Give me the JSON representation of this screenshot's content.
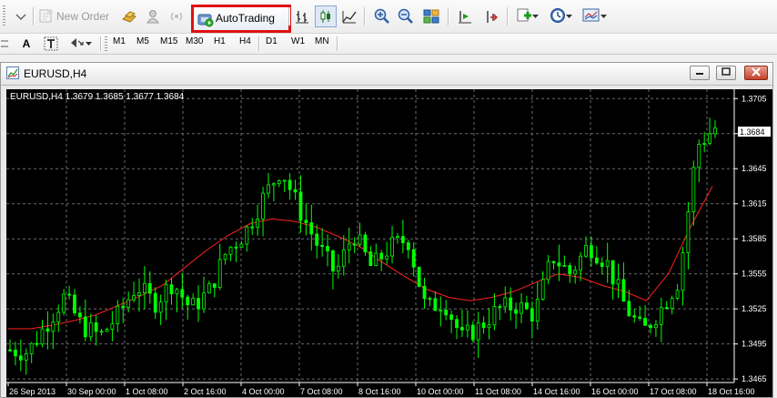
{
  "toolbar": {
    "new_order_label": "New Order",
    "autotrading_label": "AutoTrading",
    "timeframes": [
      "M1",
      "M5",
      "M15",
      "M30",
      "H1",
      "H4",
      "D1",
      "W1",
      "MN"
    ],
    "text_tool_label": "A",
    "icons": [
      "new-order-icon",
      "gold-bars-icon",
      "trader-icon",
      "signal-icon",
      "autotrading-icon",
      "bar-chart-icon",
      "candlestick-icon",
      "line-chart-icon",
      "zoom-in-icon",
      "zoom-out-icon",
      "tile-windows-icon",
      "chart-shift-icon",
      "autoscroll-icon",
      "indicators-icon",
      "periods-icon",
      "templates-icon"
    ]
  },
  "chart_window": {
    "title": "EURUSD,H4",
    "info": "EURUSD,H4  1.3679 1.3685 1.3677 1.3684",
    "current_price_label": "1.3684"
  },
  "chart_data": {
    "type": "candlestick",
    "symbol": "EURUSD",
    "timeframe": "H4",
    "ohlc_last": {
      "open": 1.3679,
      "high": 1.3685,
      "low": 1.3677,
      "close": 1.3684
    },
    "y_ticks": [
      "1.3705",
      "1.3675",
      "1.3645",
      "1.3615",
      "1.3585",
      "1.3555",
      "1.3525",
      "1.3495",
      "1.3465"
    ],
    "ylim": [
      1.3462,
      1.3713
    ],
    "x_ticks": [
      "26 Sep 2013",
      "30 Sep 00:00",
      "1 Oct 08:00",
      "2 Oct 16:00",
      "4 Oct 00:00",
      "7 Oct 08:00",
      "8 Oct 16:00",
      "10 Oct 00:00",
      "11 Oct 08:00",
      "14 Oct 16:00",
      "16 Oct 00:00",
      "17 Oct 08:00",
      "18 Oct 16:00"
    ],
    "series": [
      {
        "type": "moving_average",
        "color": "#ff2020",
        "values": [
          1.3508,
          1.3508,
          1.3511,
          1.3515,
          1.352,
          1.3528,
          1.3536,
          1.3545,
          1.356,
          1.3575,
          1.3588,
          1.3598,
          1.3602,
          1.36,
          1.3595,
          1.3587,
          1.3578,
          1.3565,
          1.3553,
          1.3542,
          1.3535,
          1.3532,
          1.3535,
          1.354,
          1.3548,
          1.3555,
          1.3552,
          1.3545,
          1.354,
          1.3532,
          1.3555,
          1.3595,
          1.363
        ]
      },
      {
        "type": "candles",
        "color": "#00ff00",
        "close": [
          1.349,
          1.3488,
          1.3512,
          1.3535,
          1.351,
          1.3502,
          1.352,
          1.3545,
          1.353,
          1.3548,
          1.3525,
          1.354,
          1.3575,
          1.359,
          1.362,
          1.3645,
          1.361,
          1.358,
          1.3555,
          1.359,
          1.356,
          1.3578,
          1.3585,
          1.3525,
          1.3532,
          1.35,
          1.351,
          1.3525,
          1.3528,
          1.352,
          1.357,
          1.3555,
          1.358,
          1.3565,
          1.3528,
          1.3505,
          1.3525,
          1.355,
          1.3665,
          1.368
        ]
      }
    ],
    "grid": true,
    "background": "#000000"
  },
  "colors": {
    "chart_bg": "#000000",
    "candle": "#00ff00",
    "ma": "#ff2020",
    "grid": "#6a6a6a",
    "axis_text": "#ffffff",
    "highlight": "#e01010"
  }
}
